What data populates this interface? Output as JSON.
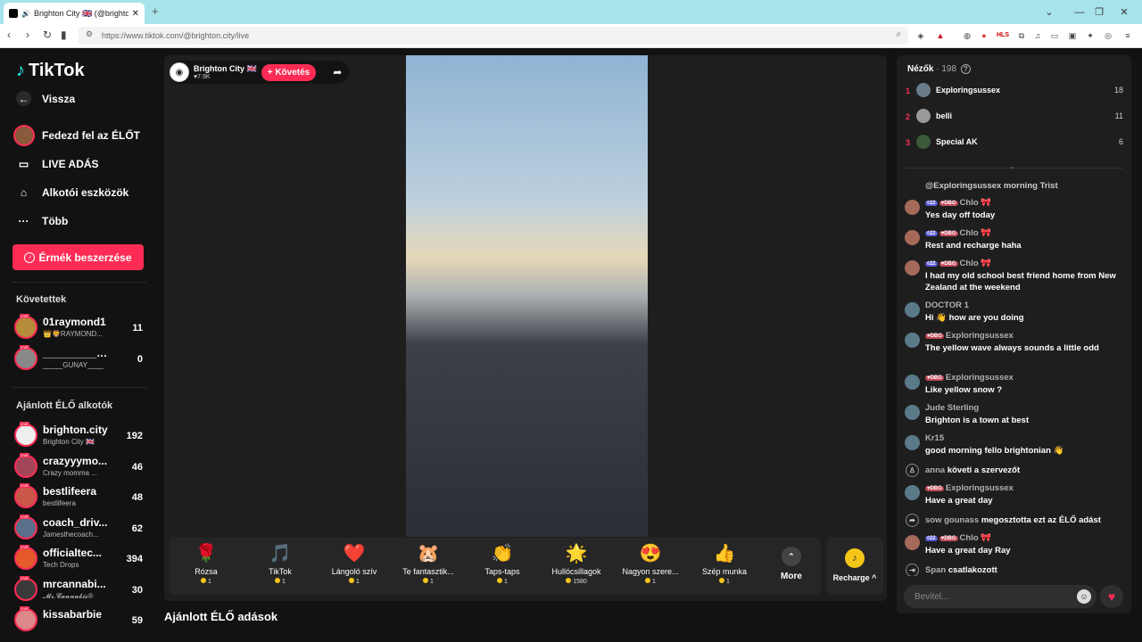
{
  "browser": {
    "tab_title": "Brighton City 🇬🇧 (@brighton.c",
    "url": "https://www.tiktok.com/@brighton.city/live"
  },
  "sidebar": {
    "logo": "TikTok",
    "back": "Vissza",
    "menu": [
      {
        "label": "Fedezd fel az ÉLŐT",
        "icon": "explore-live-icon"
      },
      {
        "label": "LIVE ADÁS",
        "icon": "video-camera-icon"
      },
      {
        "label": "Alkotói eszközök",
        "icon": "creator-tools-icon"
      },
      {
        "label": "Több",
        "icon": "more-dots-icon"
      }
    ],
    "buy_coins": "Érmék beszerzése",
    "following_header": "Követettek",
    "following": [
      {
        "name": "01raymond1",
        "sub": "👑🦁RAYMOND...",
        "count": "11"
      },
      {
        "name": "__________gu...",
        "sub": "_____GUNAY____",
        "count": "0"
      }
    ],
    "recommended_header": "Ajánlott ÉLŐ alkotók",
    "recommended": [
      {
        "name": "brighton.city",
        "sub": "Brighton City 🇬🇧",
        "count": "192"
      },
      {
        "name": "crazyyymo...",
        "sub": "Crazy momma ...",
        "count": "46"
      },
      {
        "name": "bestlifeera",
        "sub": "bestlifeera",
        "count": "48"
      },
      {
        "name": "coach_driv...",
        "sub": "Jamesthecoach...",
        "count": "62"
      },
      {
        "name": "officialtec...",
        "sub": "Tech Drops",
        "count": "394"
      },
      {
        "name": "mrcannabi...",
        "sub": "𝓜𝓻.𝓒𝓪𝓷𝓷𝓪𝓫𝓲𝓼®",
        "count": "30"
      },
      {
        "name": "kissabarbie",
        "sub": "",
        "count": "59"
      }
    ]
  },
  "player": {
    "host_name": "Brighton City 🇬🇧",
    "host_likes": "♥7.9K",
    "follow": "+ Követés",
    "gifts": [
      {
        "name": "Rózsa",
        "price": "1",
        "icon": "🌹"
      },
      {
        "name": "TikTok",
        "price": "1",
        "icon": "🎵"
      },
      {
        "name": "Lángoló szív",
        "price": "1",
        "icon": "❤️"
      },
      {
        "name": "Te fantasztik...",
        "price": "1",
        "icon": "🐹"
      },
      {
        "name": "Taps-taps",
        "price": "1",
        "icon": "👏"
      },
      {
        "name": "Hullócsillagok",
        "price": "1580",
        "icon": "🌟"
      },
      {
        "name": "Nagyon szere...",
        "price": "1",
        "icon": "😍"
      },
      {
        "name": "Szép munka",
        "price": "1",
        "icon": "👍"
      }
    ],
    "more": "More",
    "recharge": "Recharge ^"
  },
  "recommended_lives": "Ajánlott ÉLŐ adások",
  "viewers": {
    "title": "Nézők",
    "count": "· 198",
    "top": [
      {
        "rank": "1",
        "name": "Exploringsussex",
        "score": "18"
      },
      {
        "rank": "2",
        "name": "belli",
        "score": "11"
      },
      {
        "rank": "3",
        "name": "Special AK",
        "score": "6"
      }
    ]
  },
  "chat": {
    "first": "@Exploringsussex morning Trist",
    "messages": [
      {
        "name": "Chlo 🎀",
        "badges": [
          "22",
          "DBG"
        ],
        "text": "Yes day off today"
      },
      {
        "name": "Chlo 🎀",
        "badges": [
          "22",
          "DBG"
        ],
        "text": "Rest and recharge haha"
      },
      {
        "name": "Chlo 🎀",
        "badges": [
          "22",
          "DBG"
        ],
        "text": "I had my old school best friend home from New Zealand at the weekend"
      },
      {
        "name": "DOCTOR 1",
        "badges": [],
        "text": "Hi 👋 how are you doing"
      },
      {
        "name": "Exploringsussex",
        "badges": [
          "DBG"
        ],
        "text": "The yellow wave always sounds a little odd"
      },
      {
        "name": "Exploringsussex",
        "badges": [
          "DBG"
        ],
        "text": "Like yellow snow ?"
      },
      {
        "name": "Jude Sterling",
        "badges": [],
        "text": "Brighton is a town at best"
      },
      {
        "name": "Kr15",
        "badges": [],
        "text": "good morning fello brightonian 👋"
      }
    ],
    "system1": {
      "user": "anna",
      "text": "követi a szervezőt"
    },
    "messages2": [
      {
        "name": "Exploringsussex",
        "badges": [
          "DBG"
        ],
        "text": "Have a great day"
      }
    ],
    "system2": {
      "user": "sow gounass",
      "text": "megosztotta ezt az ÉLŐ adást"
    },
    "messages3": [
      {
        "name": "Chlo 🎀",
        "badges": [
          "22",
          "DBG"
        ],
        "text": "Have a great day Ray"
      }
    ],
    "system3": {
      "user": "Span",
      "text": "csatlakozott"
    },
    "input_placeholder": "Bevitel..."
  }
}
